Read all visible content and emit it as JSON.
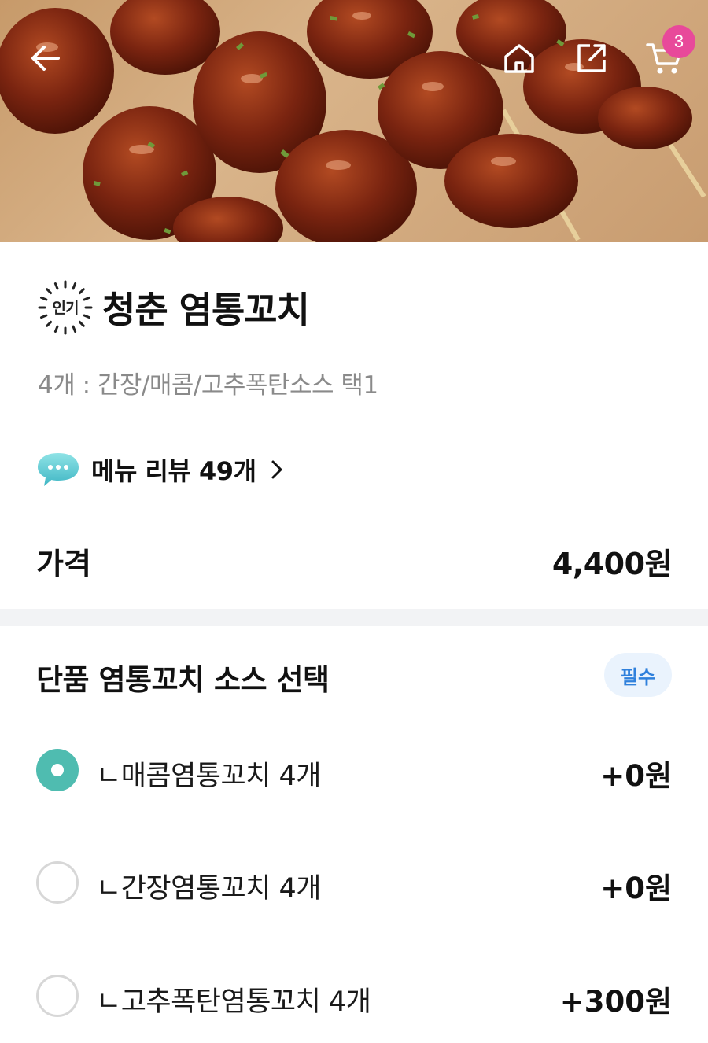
{
  "header": {
    "cart_count": "3",
    "icons": [
      "back-arrow-icon",
      "home-icon",
      "share-icon",
      "cart-icon"
    ]
  },
  "menu": {
    "badge": "인기",
    "title": "청춘 염통꼬치",
    "description": "4개 : 간장/매콤/고추폭탄소스 택1",
    "review_text": "메뉴 리뷰 49개",
    "price_label": "가격",
    "price_value": "4,400원"
  },
  "options": {
    "section_title": "단품 염통꼬치 소스 선택",
    "required_label": "필수",
    "items": [
      {
        "label": "ㄴ매콤염통꼬치 4개",
        "price": "+0원",
        "selected": true
      },
      {
        "label": "ㄴ간장염통꼬치 4개",
        "price": "+0원",
        "selected": false
      },
      {
        "label": "ㄴ고추폭탄염통꼬치 4개",
        "price": "+300원",
        "selected": false
      }
    ]
  },
  "colors": {
    "accent_teal": "#4fbcb0",
    "badge_pink": "#e8499a",
    "required_blue": "#2f80dc",
    "required_bg": "#eaf3fd"
  }
}
